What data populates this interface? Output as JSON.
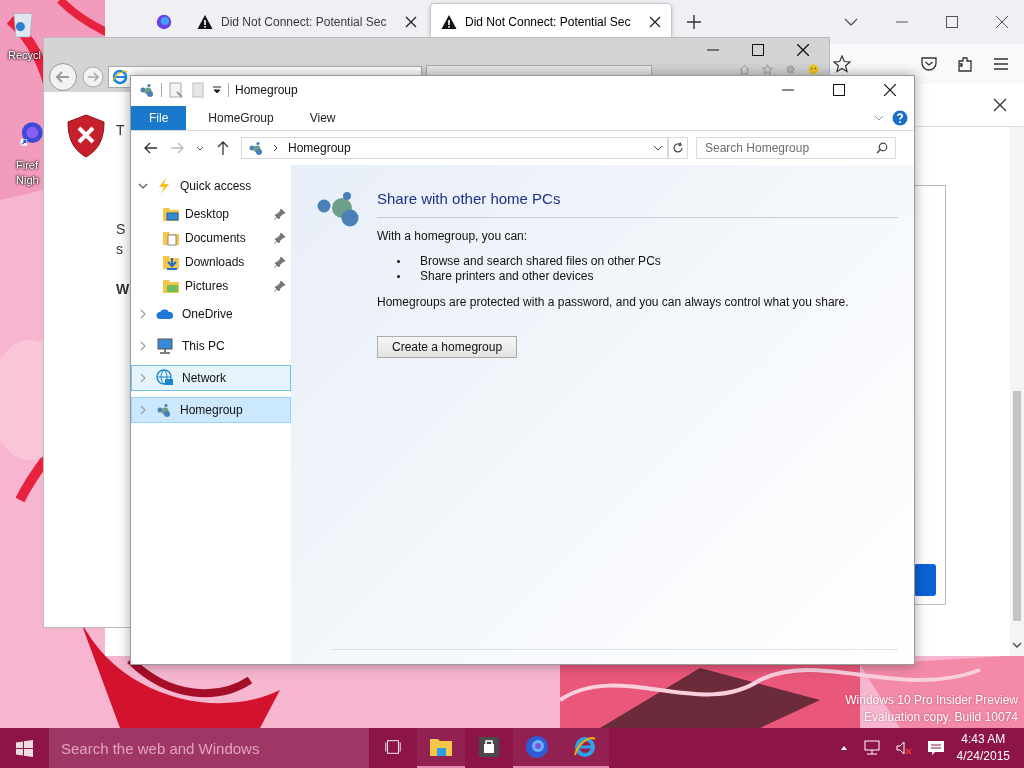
{
  "desktop": {
    "icons": [
      {
        "kind": "recycle",
        "lines": [
          "Recycl"
        ]
      },
      {
        "kind": "firefox",
        "lines": [
          "Firef",
          "Nigh"
        ]
      }
    ],
    "watermark": [
      "Windows 10 Pro Insider Preview",
      "Evaluation copy. Build 10074"
    ]
  },
  "firefox": {
    "tabs": [
      {
        "title": "Did Not Connect: Potential Sec",
        "selected": false
      },
      {
        "title": "Did Not Connect: Potential Sec",
        "selected": true
      }
    ]
  },
  "ie": {
    "fragments": [
      "T",
      "S",
      "s",
      "W"
    ]
  },
  "explorer": {
    "title": "Homegroup",
    "ribbon_tabs": [
      {
        "label": "File",
        "selected": true
      },
      {
        "label": "HomeGroup",
        "selected": false
      },
      {
        "label": "View",
        "selected": false
      }
    ],
    "address": "Homegroup",
    "search": {
      "placeholder": "Search Homegroup"
    },
    "nav": [
      {
        "label": "Quick access",
        "kind": "quick",
        "expanded": true,
        "selected": false,
        "hovered": false,
        "children": [
          {
            "label": "Desktop",
            "kind": "desktop",
            "pinned": true
          },
          {
            "label": "Documents",
            "kind": "documents",
            "pinned": true
          },
          {
            "label": "Downloads",
            "kind": "downloads",
            "pinned": true
          },
          {
            "label": "Pictures",
            "kind": "pictures",
            "pinned": true
          }
        ]
      },
      {
        "label": "OneDrive",
        "kind": "onedrive",
        "expanded": false,
        "selected": false,
        "hovered": false
      },
      {
        "label": "This PC",
        "kind": "pc",
        "expanded": false,
        "selected": false,
        "hovered": false
      },
      {
        "label": "Network",
        "kind": "network",
        "expanded": false,
        "selected": false,
        "hovered": true
      },
      {
        "label": "Homegroup",
        "kind": "homegroup",
        "expanded": false,
        "selected": true,
        "hovered": false
      }
    ],
    "content": {
      "heading": "Share with other home PCs",
      "intro": "With a homegroup, you can:",
      "bullets": [
        "Browse and search shared files on other PCs",
        "Share printers and other devices"
      ],
      "note": "Homegroups are protected with a password, and you can always control what you share.",
      "button": "Create a homegroup"
    }
  },
  "taskbar": {
    "search": {
      "placeholder": "Search the web and Windows"
    },
    "apps": [
      {
        "kind": "explorer",
        "running": true
      },
      {
        "kind": "store",
        "running": false
      },
      {
        "kind": "firefox",
        "running": true
      },
      {
        "kind": "ie",
        "running": true
      }
    ],
    "time": "4:43 AM",
    "date": "4/24/2015"
  }
}
